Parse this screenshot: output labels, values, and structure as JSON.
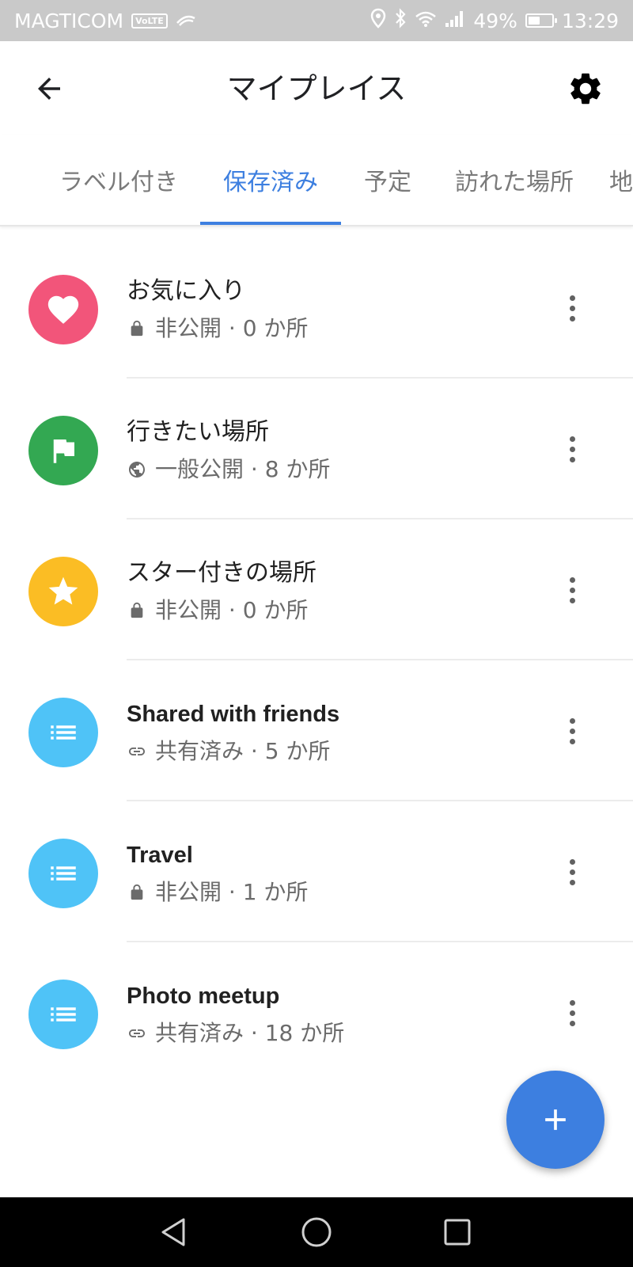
{
  "status_bar": {
    "carrier": "MAGTICOM",
    "volte": "VoLTE",
    "battery_percent": "49%",
    "battery_level": 0.49,
    "time": "13:29",
    "icons": [
      "location-icon",
      "bluetooth-icon",
      "wifi-icon",
      "signal-icon",
      "battery-icon"
    ]
  },
  "app_bar": {
    "title": "マイプレイス",
    "back_icon": "arrow-back-icon",
    "settings_icon": "gear-icon"
  },
  "tabs": [
    {
      "label": "ラベル付き",
      "active": false
    },
    {
      "label": "保存済み",
      "active": true
    },
    {
      "label": "予定",
      "active": false
    },
    {
      "label": "訪れた場所",
      "active": false
    },
    {
      "label": "地",
      "active": false
    }
  ],
  "lists": [
    {
      "title": "お気に入り",
      "visibility": "非公開",
      "count": "0 か所",
      "meta": "非公開 · 0 か所",
      "icon": "heart-icon",
      "meta_icon": "lock-icon",
      "color": "#f2557a"
    },
    {
      "title": "行きたい場所",
      "visibility": "一般公開",
      "count": "8 か所",
      "meta": "一般公開 · 8 か所",
      "icon": "flag-icon",
      "meta_icon": "globe-icon",
      "color": "#33a852"
    },
    {
      "title": "スター付きの場所",
      "visibility": "非公開",
      "count": "0 か所",
      "meta": "非公開 · 0 か所",
      "icon": "star-icon",
      "meta_icon": "lock-icon",
      "color": "#fbbd24"
    },
    {
      "title": "Shared with friends",
      "visibility": "共有済み",
      "count": "5 か所",
      "meta": "共有済み · 5 か所",
      "icon": "list-icon",
      "meta_icon": "link-icon",
      "color": "#4fc3f7"
    },
    {
      "title": "Travel",
      "visibility": "非公開",
      "count": "1 か所",
      "meta": "非公開 · 1 か所",
      "icon": "list-icon",
      "meta_icon": "lock-icon",
      "color": "#4fc3f7"
    },
    {
      "title": "Photo meetup",
      "visibility": "共有済み",
      "count": "18 か所",
      "meta": "共有済み · 18 か所",
      "icon": "list-icon",
      "meta_icon": "link-icon",
      "color": "#4fc3f7"
    }
  ],
  "fab": {
    "icon": "plus-icon",
    "color": "#3d7fe0"
  },
  "nav_bar": {
    "icons": [
      "nav-back-icon",
      "nav-home-icon",
      "nav-recents-icon"
    ]
  }
}
